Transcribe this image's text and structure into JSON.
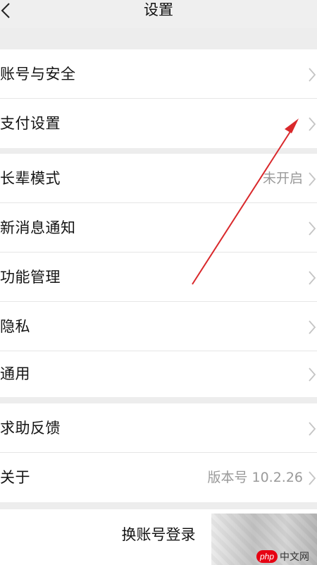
{
  "header": {
    "title": "设置",
    "back_icon": "chevron-left-icon"
  },
  "groups": [
    {
      "items": [
        {
          "label": "账号与安全",
          "value": ""
        },
        {
          "label": "支付设置",
          "value": ""
        }
      ]
    },
    {
      "items": [
        {
          "label": "长辈模式",
          "value": "未开启"
        },
        {
          "label": "新消息通知",
          "value": ""
        },
        {
          "label": "功能管理",
          "value": ""
        },
        {
          "label": "隐私",
          "value": ""
        },
        {
          "label": "通用",
          "value": ""
        }
      ]
    },
    {
      "items": [
        {
          "label": "求助反馈",
          "value": ""
        },
        {
          "label": "关于",
          "value": "版本号 10.2.26"
        }
      ]
    }
  ],
  "logout": {
    "label": "换账号登录"
  },
  "watermark": {
    "badge": "php",
    "text": "中文网"
  },
  "colors": {
    "annotation_arrow": "#d9282b",
    "background": "#ededed",
    "card": "#ffffff",
    "secondary_text": "#9a9a9a"
  }
}
